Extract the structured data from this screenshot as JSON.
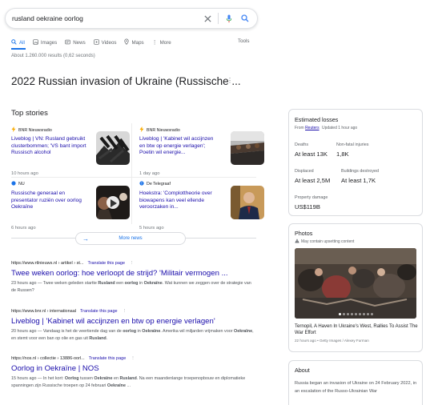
{
  "search": {
    "query": "rusland oekraine oorlog",
    "icons": [
      "close-icon",
      "mic-icon",
      "search-icon"
    ]
  },
  "tabs": [
    {
      "label": "All",
      "icon": "search-icon",
      "active": true
    },
    {
      "label": "Images",
      "icon": "image-icon",
      "active": false
    },
    {
      "label": "News",
      "icon": "news-icon",
      "active": false
    },
    {
      "label": "Videos",
      "icon": "video-icon",
      "active": false
    },
    {
      "label": "Maps",
      "icon": "map-pin-icon",
      "active": false
    },
    {
      "label": "More",
      "icon": "more-vert-icon",
      "active": false
    }
  ],
  "tools_label": "Tools",
  "result_stats": "About 1.260.000 results (0,62 seconds)",
  "knowledge_title": "2022 Russian invasion of Ukraine (Russische ...",
  "top_stories": {
    "title": "Top stories",
    "items": [
      {
        "source": "BNR Nieuwsradio",
        "headline": "Liveblog | VN: Rusland gebruikt clusterbommen; 'VS bant import Russisch alcohol",
        "time": "10 hours ago",
        "source_color": "#f9ab00"
      },
      {
        "source": "BNR Nieuwsradio",
        "headline": "Liveblog | 'Kabinet wil accijnzen en btw op energie verlagen'; Poetin wil energie...",
        "time": "1 day ago",
        "source_color": "#f9ab00"
      },
      {
        "source": "NU",
        "headline": "Russische generaal en presentator ruziën over oorlog Oekraïne",
        "time": "6 hours ago",
        "source_color": "#1a73e8"
      },
      {
        "source": "De Telegraaf",
        "headline": "Hoekstra: 'Complottheorie over biowapens kan veel ellende veroorzaken in...",
        "time": "5 hours ago",
        "source_color": "#1a73e8"
      }
    ],
    "more_news": "More news"
  },
  "results": [
    {
      "url": "https://www.rtlnieuws.nl › artikel › st...",
      "translate": "Translate this page",
      "title": "Twee weken oorlog: hoe verloopt de strijd? 'Militair vermogen ...",
      "snippet_parts": [
        {
          "t": "23 hours ago — Twee weken geleden startte ",
          "b": false
        },
        {
          "t": "Rusland",
          "b": true
        },
        {
          "t": " een ",
          "b": false
        },
        {
          "t": "oorlog",
          "b": true
        },
        {
          "t": " in ",
          "b": false
        },
        {
          "t": "Oekraïne",
          "b": true
        },
        {
          "t": ". Wat kunnen we zeggen over de strategie van de Russen?",
          "b": false
        }
      ]
    },
    {
      "url": "https://www.bnr.nl › internationaal",
      "translate": "Translate this page",
      "title": "Liveblog | 'Kabinet wil accijnzen en btw op energie verlagen'",
      "snippet_parts": [
        {
          "t": "20 hours ago — Vandaag is het de veertiende dag van de ",
          "b": false
        },
        {
          "t": "oorlog",
          "b": true
        },
        {
          "t": " in ",
          "b": false
        },
        {
          "t": "Oekraïne",
          "b": true
        },
        {
          "t": ". Amerika wil miljarden vrijmaken voor ",
          "b": false
        },
        {
          "t": "Oekraïne",
          "b": true
        },
        {
          "t": ", en stemt voor een ban op olie en gas uit ",
          "b": false
        },
        {
          "t": "Rusland",
          "b": true
        },
        {
          "t": ".",
          "b": false
        }
      ]
    },
    {
      "url": "https://nos.nl › collectie › 13886-oorl...",
      "translate": "Translate this page",
      "title": "Oorlog in Oekraïne | NOS",
      "snippet_parts": [
        {
          "t": "15 hours ago — In het kort: ",
          "b": false
        },
        {
          "t": "Oorlog",
          "b": true
        },
        {
          "t": " tussen ",
          "b": false
        },
        {
          "t": "Oekraïne",
          "b": true
        },
        {
          "t": " en ",
          "b": false
        },
        {
          "t": "Rusland",
          "b": true
        },
        {
          "t": ". Na een maandenlange troepenopbouw en diplomatieke spanningen zijn Russische troepen op 24 februari ",
          "b": false
        },
        {
          "t": "Oekraïne",
          "b": true
        },
        {
          "t": " ...",
          "b": false
        }
      ]
    }
  ],
  "losses": {
    "title": "Estimated losses",
    "from_label": "From",
    "source": "Reuters",
    "updated": "Updated 1 hour ago",
    "stats": [
      {
        "label": "Deaths",
        "value": "At least 13K"
      },
      {
        "label": "Non-fatal injuries",
        "value": "1,8K"
      },
      {
        "label": "Displaced",
        "value": "At least 2,5M"
      },
      {
        "label": "Buildings destroyed",
        "value": "At least 1,7K"
      },
      {
        "label": "Property damage",
        "value": "US$119B"
      }
    ]
  },
  "photos": {
    "title": "Photos",
    "warning": "May contain upsetting content",
    "caption": "Ternopil, A Haven In Ukraine's West, Rallies To Assist The War Effort",
    "meta": "22 hours ago • Getty Images / Alexey Furman"
  },
  "about": {
    "title": "About",
    "text": "Russia began an invasion of Ukraine on 24 February 2022, in an escalation of the Russo-Ukrainian War"
  }
}
